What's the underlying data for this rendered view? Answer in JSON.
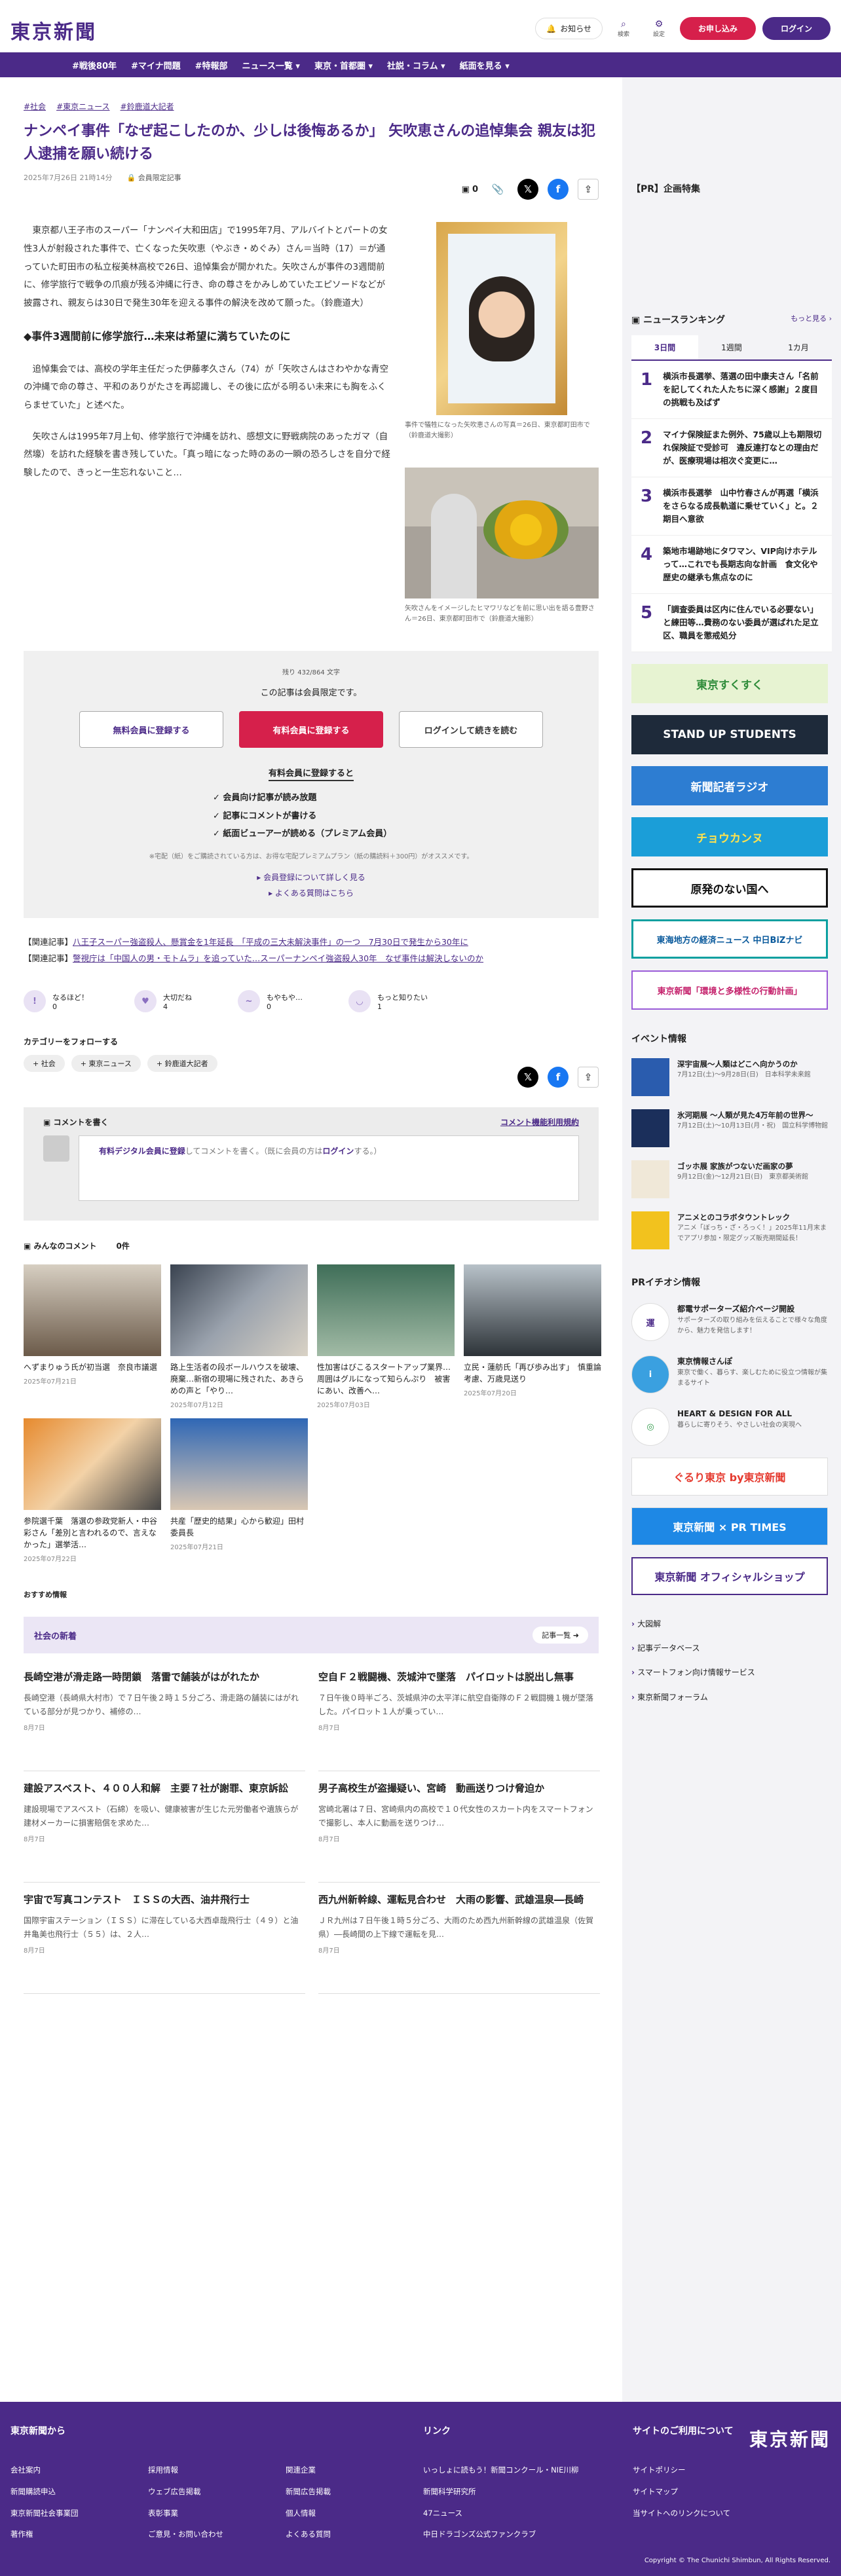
{
  "header": {
    "logo": "東京新聞",
    "notice": "お知らせ",
    "search": "検索",
    "settings": "設定",
    "apply": "お申し込み",
    "login": "ログイン"
  },
  "nav": [
    "#戦後80年",
    "#マイナ問題",
    "#特報部",
    "ニュース一覧 ▾",
    "東京・首都圏 ▾",
    "社説・コラム ▾",
    "紙面を見る ▾"
  ],
  "article": {
    "tags": [
      "#社会",
      "#東京ニュース",
      "#鈴鹿道大記者"
    ],
    "title": "ナンペイ事件「なぜ起こしたのか、少しは後悔あるか」 矢吹恵さんの追悼集会 親友は犯人逮捕を願い続ける",
    "date": "2025年7月26日 21時14分",
    "limited": "会員限定記事",
    "comment_count": "0",
    "p1": "東京都八王子市のスーパー「ナンペイ大和田店」で1995年7月、アルバイトとパートの女性3人が射殺された事件で、亡くなった矢吹恵（やぶき・めぐみ）さん＝当時（17）＝が通っていた町田市の私立桜美林高校で26日、追悼集会が開かれた。矢吹さんが事件の3週間前に、修学旅行で戦争の爪痕が残る沖縄に行き、命の尊さをかみしめていたエピソードなどが披露され、親友らは30日で発生30年を迎える事件の解決を改めて願った。（鈴鹿道大）",
    "h2": "◆事件3週間前に修学旅行…未来は希望に満ちていたのに",
    "p2": "追悼集会では、高校の学年主任だった伊藤孝久さん（74）が「矢吹さんはさわやかな青空の沖縄で命の尊さ、平和のありがたさを再認識し、その後に広がる明るい未来にも胸をふくらませていた」と述べた。",
    "p3": "矢吹さんは1995年7月上旬、修学旅行で沖縄を訪れ、感想文に野戦病院のあったガマ（自然壕）を訪れた経験を書き残していた。「真っ暗になった時のあの一瞬の恐ろしさを自分で経験したので、きっと一生忘れないこと…",
    "cap1": "事件で犠牲になった矢吹恵さんの写真＝26日、東京都町田市で（鈴鹿道大撮影）",
    "cap2": "矢吹さんをイメージしたヒマワリなどを前に思い出を語る豊野さん＝26日、東京都町田市で（鈴鹿道大撮影）"
  },
  "paywall": {
    "remain": "残り 432/864 文字",
    "msg": "この記事は会員限定です。",
    "free": "無料会員に登録する",
    "paid": "有料会員に登録する",
    "login": "ログインして続きを読む",
    "sub": "有料会員に登録すると",
    "benefits": [
      "会員向け記事が読み放題",
      "記事にコメントが書ける",
      "紙面ビューアーが読める（プレミアム会員）"
    ],
    "note": "※宅配（紙）をご購読されている方は、お得な宅配プレミアムプラン（紙の購読料＋300円）がオススメです。",
    "link1": "▸ 会員登録について詳しく見る",
    "link2": "▸ よくある質問はこちら"
  },
  "related": [
    {
      "label": "【関連記事】",
      "text": "八王子スーパー強盗殺人、懸賞金を1年延長　「平成の三大未解決事件」の一つ　7月30日で発生から30年に"
    },
    {
      "label": "【関連記事】",
      "text": "警視庁は「中国人の男・モトムラ」を追っていた…スーパーナンペイ強盗殺人30年　なぜ事件は解決しないのか"
    }
  ],
  "reactions": [
    {
      "label": "なるほど！",
      "count": "0"
    },
    {
      "label": "大切だね",
      "count": "4"
    },
    {
      "label": "もやもや…",
      "count": "0"
    },
    {
      "label": "もっと知りたい",
      "count": "1"
    }
  ],
  "follow": {
    "title": "カテゴリーをフォローする",
    "tags": [
      "+ 社会",
      "+ 東京ニュース",
      "+ 鈴鹿道大記者"
    ]
  },
  "comment": {
    "head": "コメントを書く",
    "rule": "コメント機能利用規約",
    "link": "有料デジタル会員に登録",
    "text1": "してコメントを書く。（既に会員の方は",
    "login": "ログイン",
    "text2": "する。）"
  },
  "everyone": {
    "title": "みんなのコメント",
    "count": "0件"
  },
  "thumbs": [
    {
      "t": "へずまりゅう氏が初当選　奈良市議選",
      "d": "2025年07月21日"
    },
    {
      "t": "路上生活者の段ボールハウスを破壊、廃棄…新宿の現場に残された、あきらめの声と「やり…",
      "d": "2025年07月12日"
    },
    {
      "t": "性加害はびこるスタートアップ業界…周囲はグルになって知らんぷり　被害にあい、改善へ…",
      "d": "2025年07月03日"
    },
    {
      "t": "立民・蓮舫氏「再び歩み出す」　慎重論考慮、万歳見送り",
      "d": "2025年07月20日"
    },
    {
      "t": "参院選千葉　落選の参政党新人・中谷彩さん「差別と言われるので、言えなかった」選挙活…",
      "d": "2025年07月22日"
    },
    {
      "t": "共産「歴史的結果」心から歓迎」田村委員長",
      "d": "2025年07月21日"
    }
  ],
  "recommend": "おすすめ情報",
  "society": {
    "title": "社会の新着",
    "more": "記事一覧"
  },
  "news": [
    {
      "t": "長崎空港が滑走路一時閉鎖　落雷で舗装がはがれたか",
      "b": "長崎空港（長崎県大村市）で７日午後２時１５分ごろ、滑走路の舗装にはがれている部分が見つかり、補修の…",
      "d": "8月7日"
    },
    {
      "t": "空自Ｆ２戦闘機、茨城沖で墜落　パイロットは脱出し無事",
      "b": "７日午後０時半ごろ、茨城県沖の太平洋に航空自衛隊のＦ２戦闘機１機が墜落した。パイロット１人が乗ってい…",
      "d": "8月7日"
    },
    {
      "t": "建設アスベスト、４００人和解　主要７社が謝罪、東京訴訟",
      "b": "建設現場でアスベスト（石綿）を吸い、健康被害が生じた元労働者や遺族らが建材メーカーに損害賠償を求めた…",
      "d": "8月7日"
    },
    {
      "t": "男子高校生が盗撮疑い、宮崎　動画送りつけ脅迫か",
      "b": "宮崎北署は７日、宮崎県内の高校で１０代女性のスカート内をスマートフォンで撮影し、本人に動画を送りつけ…",
      "d": "8月7日"
    },
    {
      "t": "宇宙で写真コンテスト　ＩＳＳの大西、油井飛行士",
      "b": "国際宇宙ステーション（ＩＳＳ）に滞在している大西卓哉飛行士（４９）と油井亀美也飛行士（５５）は、２人…",
      "d": "8月7日"
    },
    {
      "t": "西九州新幹線、運転見合わせ　大雨の影響、武雄温泉―長崎",
      "b": "ＪＲ九州は７日午後１時５分ごろ、大雨のため西九州新幹線の武雄温泉（佐賀県）―長崎間の上下線で運転を見…",
      "d": "8月7日"
    }
  ],
  "sidebar": {
    "pr": "【PR】企画特集",
    "ranking": "ニュースランキング",
    "ranking_more": "もっと見る ›",
    "tabs": [
      "3日間",
      "1週間",
      "1カ月"
    ],
    "items": [
      "横浜市長選挙、落選の田中康夫さん「名前を記してくれた人たちに深く感謝」２度目の挑戦も及ばず",
      "マイナ保険証また例外、75歳以上も期限切れ保険証で受診可　違反連打なとの理由だが、医療現場は相次ぐ変更に…",
      "横浜市長選挙　山中竹春さんが再選「横浜をさらなる成長軌道に乗せていく」と。２期目へ意欲",
      "築地市場跡地にタワマン、VIP向けホテルって…これでも長期志向な計画　食文化や歴史の継承も焦点なのに",
      "「調査委員は区内に住んでいる必要ない」と練田等…費務のない委員が選ばれた足立区、職員を懲戒処分"
    ],
    "banners": [
      "東京すくすく",
      "STAND UP STUDENTS",
      "新聞記者ラジオ",
      "チョウカンヌ",
      "原発のない国へ",
      "東海地方の経済ニュース 中日BiZナビ",
      "東京新聞「環境と多様性の行動計画」"
    ],
    "events_title": "イベント情報",
    "events": [
      {
        "t": "深宇宙展〜人類はどこへ向かうのか",
        "s": "7月12日(土)〜9月28日(日)　日本科学未来館"
      },
      {
        "t": "氷河期展 〜人類が見た4万年前の世界〜",
        "s": "7月12日(土)〜10月13日(月・祝)　国立科学博物館"
      },
      {
        "t": "ゴッホ展 家族がつないだ画家の夢",
        "s": "9月12日(金)〜12月21日(日)　東京都美術館"
      },
      {
        "t": "アニメとのコラボタウントレック",
        "s": "アニメ「ぼっち・ざ・ろっく！」2025年11月末までアプリ参加・限定グッズ販売期間延長！"
      }
    ],
    "pri_title": "PRイチオシ情報",
    "pri": [
      {
        "icon": "運",
        "t": "都電サポーターズ紹介ページ開設",
        "s": "サポーターズの取り組みを伝えることで様々な角度から、魅力を発信します！"
      },
      {
        "icon": "i",
        "t": "東京情報さんぽ",
        "s": "東京で働く、暮らす、楽しむために役立つ情報が集まるサイト"
      },
      {
        "icon": "◎",
        "t": "HEART & DESIGN FOR ALL",
        "s": "暮らしに寄りそう、やさしい社会の実現へ"
      }
    ],
    "small_banners": [
      "ぐるり東京 by東京新聞",
      "東京新聞 × PR TIMES",
      "東京新聞 オフィシャルショップ"
    ],
    "links": [
      "大図解",
      "記事データベース",
      "スマートフォン向け情報サービス",
      "東京新聞フォーラム"
    ]
  },
  "footer": {
    "col1_title": "東京新聞から",
    "col1a": [
      "会社案内",
      "新聞購読申込",
      "東京新聞社会事業団",
      "著作権"
    ],
    "col1b": [
      "採用情報",
      "ウェブ広告掲載",
      "表彰事業",
      "ご意見・お問い合わせ"
    ],
    "col1c": [
      "関連企業",
      "新聞広告掲載",
      "個人情報",
      "よくある質問"
    ],
    "col2_title": "リンク",
    "col2": [
      "いっしょに読もう！新聞コンクール・NIE川柳",
      "新聞科学研究所",
      "47ニュース",
      "中日ドラゴンズ公式ファンクラブ"
    ],
    "col3_title": "サイトのご利用について",
    "col3": [
      "サイトポリシー",
      "サイトマップ",
      "当サイトへのリンクについて"
    ],
    "logo": "東京新聞",
    "copyright": "Copyright © The Chunichi Shimbun, All Rights Reserved."
  }
}
